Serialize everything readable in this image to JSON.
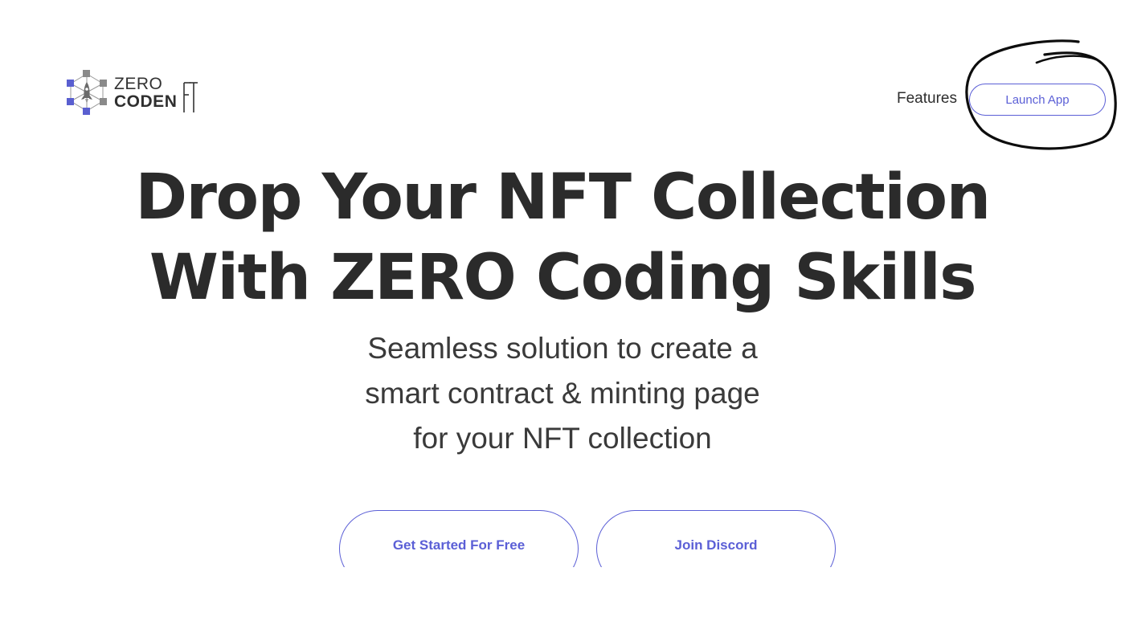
{
  "logo": {
    "line1": "ZERO",
    "line2": "CODE",
    "line2_suffix": "N",
    "ft": "FT"
  },
  "nav": {
    "features_label": "Features",
    "launch_label": "Launch App"
  },
  "hero": {
    "title_line1": "Drop Your NFT Collection",
    "title_line2": "With ZERO Coding Skills",
    "subtitle_line1": "Seamless solution to create a",
    "subtitle_line2": "smart contract & minting page",
    "subtitle_line3": "for your NFT collection"
  },
  "cta": {
    "primary_label": "Get Started For Free",
    "secondary_label": "Join Discord"
  },
  "colors": {
    "accent": "#5b5fd6",
    "text": "#2b2b2b",
    "logo_cube": "#5a5fd0",
    "logo_gray": "#8a8a8a"
  },
  "icons": {
    "logo_mark": "blockchain-rocket-icon",
    "annotation": "hand-drawn-circle"
  }
}
